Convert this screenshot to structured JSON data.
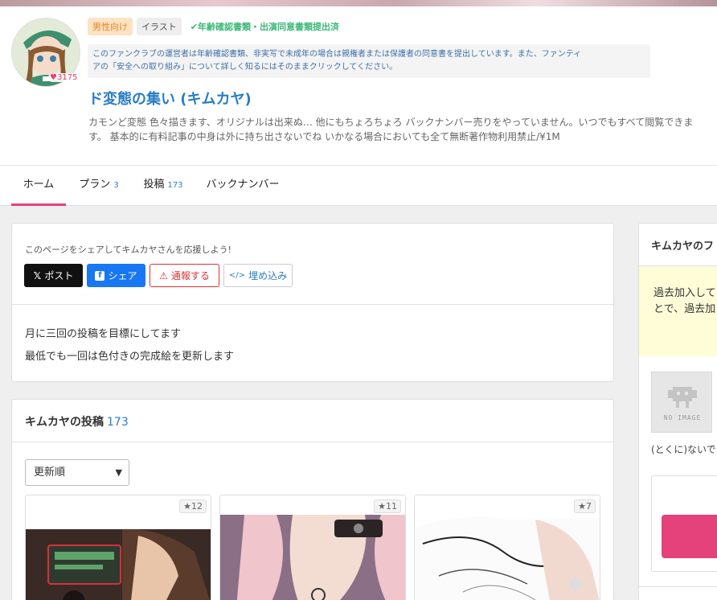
{
  "header": {
    "avatar_alt": "キムカヤ avatar",
    "fav_count": "3175",
    "tags": [
      "男性向け",
      "イラスト"
    ],
    "verified_text": "年齢確認書類・出演同意書類提出済",
    "notice_line1": "このファンクラブの運営者は年齢確認書類、非実写で未成年の場合は親権者または保護者の同意書を提出しています。また、ファンティ",
    "notice_line2": "アの「安全への取り組み」について詳しく知るにはそのままクリックしてください。",
    "club_title": "ド変態の集い (キムカヤ)",
    "club_description": "カモンど変態 色々描きます、オリジナルは出来ぬ… 他にもちょろちょろ バックナンバー売りをやっていません。いつでもすべて閲覧できます。 基本的に有料記事の中身は外に持ち出さないでね いかなる場合においても全て無断著作物利用禁止/¥1M"
  },
  "tabs": [
    {
      "label": "ホーム",
      "count": ""
    },
    {
      "label": "プラン",
      "count": "3"
    },
    {
      "label": "投稿",
      "count": "173"
    },
    {
      "label": "バックナンバー",
      "count": ""
    }
  ],
  "share": {
    "prompt": "このページをシェアしてキムカヤさんを応援しよう!",
    "x_label": "ポスト",
    "fb_label": "シェア",
    "report_label": "通報する",
    "embed_label": "埋め込み"
  },
  "about": {
    "line1": "月に三回の投稿を目標にしてます",
    "line2": "最低でも一回は色付きの完成絵を更新します"
  },
  "posts": {
    "title": "キムカヤの投稿",
    "count": "173",
    "sort_value": "更新順",
    "items": [
      {
        "likes": "12"
      },
      {
        "likes": "11"
      },
      {
        "likes": "7"
      }
    ]
  },
  "sidebar": {
    "title": "キムカヤのフ",
    "yellow_line1": "過去加入して",
    "yellow_line2": "とで、過去加",
    "noimage_label": "NO IMAGE",
    "plan_name": "(とくに)ないで"
  },
  "colors": {
    "accent_pink": "#e5417b",
    "link_blue": "#2a7dc6",
    "verified_green": "#3cb878"
  }
}
